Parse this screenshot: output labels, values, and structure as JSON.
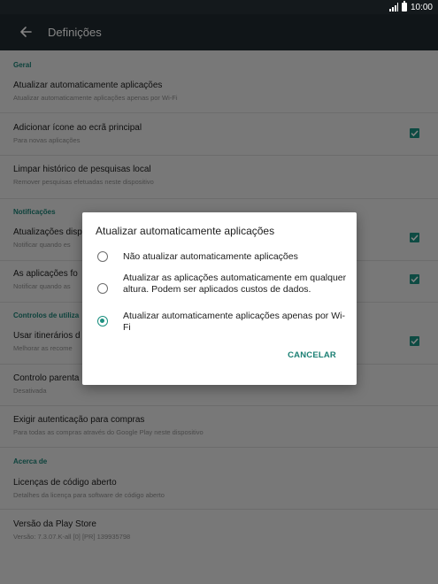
{
  "status_bar": {
    "time": "10:00"
  },
  "app_bar": {
    "title": "Definições"
  },
  "sections": {
    "geral": "Geral",
    "notificacoes": "Notificações",
    "controlos": "Controlos de utiliza",
    "acerca": "Acerca de"
  },
  "items": {
    "atualizar": {
      "title": "Atualizar automaticamente aplicações",
      "sub": "Atualizar automaticamente aplicações apenas por Wi-Fi"
    },
    "adicionar_icone": {
      "title": "Adicionar ícone ao ecrã principal",
      "sub": "Para novas aplicações",
      "checked": true
    },
    "limpar_historico": {
      "title": "Limpar histórico de pesquisas local",
      "sub": "Remover pesquisas efetuadas neste dispositivo"
    },
    "atualizacoes": {
      "title": "Atualizações disp",
      "sub": "Notificar quando es",
      "checked": true
    },
    "as_aplicacoes": {
      "title": "As aplicações fo",
      "sub": "Notificar quando as",
      "checked": true
    },
    "usar_itinerarios": {
      "title": "Usar itinerários d",
      "sub": "Melhorar as recome",
      "checked": true
    },
    "controlo_parental": {
      "title": "Controlo parenta",
      "sub": "Desativada"
    },
    "exigir_autenticacao": {
      "title": "Exigir autenticação para compras",
      "sub": "Para todas as compras através do Google Play neste dispositivo"
    },
    "licencas": {
      "title": "Licenças de código aberto",
      "sub": "Detalhes da licença para software de código aberto"
    },
    "versao": {
      "title": "Versão da Play Store",
      "sub": "Versão: 7.3.07.K-all [0] [PR] 139935798"
    }
  },
  "dialog": {
    "title": "Atualizar automaticamente aplicações",
    "options": [
      {
        "label": "Não atualizar automaticamente aplicações",
        "selected": false
      },
      {
        "label": "Atualizar as aplicações automaticamente em qualquer altura. Podem ser aplicados custos de dados.",
        "selected": false
      },
      {
        "label": "Atualizar automaticamente aplicações apenas por Wi-Fi",
        "selected": true
      }
    ],
    "cancel_label": "CANCELAR"
  },
  "colors": {
    "accent": "#1c9080",
    "app_bar": "#1f292f",
    "status_bar": "#14191c"
  }
}
